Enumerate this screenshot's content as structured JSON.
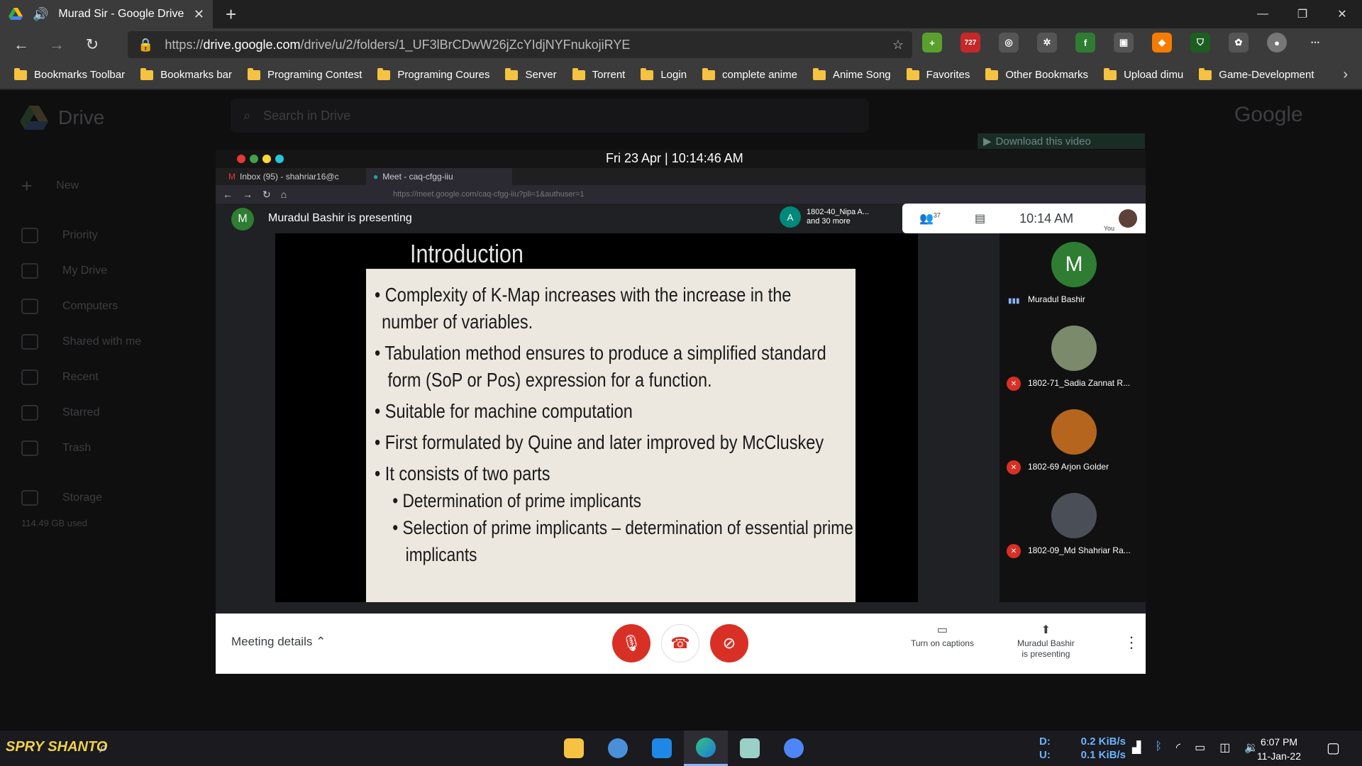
{
  "browser": {
    "tab_title": "Murad Sir - Google Drive",
    "url_host": "drive.google.com",
    "url_path": "/drive/u/2/folders/1_UF3lBrCDwW26jZcYIdjNYFnukojiRYE",
    "url_prefix": "https://",
    "new_tab": "+",
    "extension_badge": "727",
    "bookmarks": [
      "Bookmarks Toolbar",
      "Bookmarks bar",
      "Programing Contest",
      "Programing Coures",
      "Server",
      "Torrent",
      "Login",
      "complete anime",
      "Anime Song",
      "Favorites",
      "Other Bookmarks",
      "Upload dimu",
      "Game-Development"
    ]
  },
  "drive": {
    "logo_text": "Drive",
    "search_placeholder": "Search in Drive",
    "new_label": "New",
    "sidebar": [
      "Priority",
      "My Drive",
      "Computers",
      "Shared with me",
      "Recent",
      "Starred",
      "Trash"
    ],
    "storage_label": "Storage",
    "storage_used": "114.49 GB used",
    "google_word": "Google"
  },
  "video": {
    "download_label": "Download this video",
    "mac_clock": "Fri 23 Apr | 10:14:46 AM",
    "ff_tab1": "Inbox (95) - shahriar16@c",
    "ff_tab2": "Meet - caq-cfgg-iiu",
    "ff_url": "https://meet.google.com/caq-cfgg-iiu?pli=1&authuser=1",
    "presenter_initial": "M",
    "presenting_text": "Muradul Bashir is presenting",
    "participant_initial": "A",
    "participant_name": "1802-40_Nipa A...",
    "participant_more": "and 30 more",
    "people_count": "37",
    "meet_time": "10:14 AM",
    "you_label": "You",
    "slide": {
      "title": "Introduction",
      "bullets": [
        "Complexity of K-Map increases with the increase in the",
        "number of variables.",
        "Tabulation method ensures to produce a simplified standard",
        "form (SoP or Pos) expression for a function.",
        "Suitable for machine computation",
        "First formulated by Quine and later improved by McCluskey",
        "It consists of two parts",
        "Determination of prime implicants",
        "Selection of prime implicants – determination of essential prime",
        "implicants"
      ]
    },
    "tiles": [
      {
        "initial": "M",
        "name": "Muradul Bashir",
        "color": "#2e7d32"
      },
      {
        "initial": "",
        "name": "1802-71_Sadia Zannat R...",
        "color": "#7a8a6a"
      },
      {
        "initial": "",
        "name": "1802-69 Arjon Golder",
        "color": "#b5651d"
      },
      {
        "initial": "",
        "name": "1802-09_Md Shahriar Ra...",
        "color": "#4a4f57"
      }
    ],
    "meeting_details": "Meeting details",
    "captions_label": "Turn on captions",
    "presenting_btn_line1": "Muradul Bashir",
    "presenting_btn_line2": "is presenting"
  },
  "taskbar": {
    "start_label": "SPRY SHANTO",
    "net_d_label": "D:",
    "net_u_label": "U:",
    "net_down": "0.2 KiB/s",
    "net_up": "0.1 KiB/s",
    "time": "6:07 PM",
    "date": "11-Jan-22"
  }
}
